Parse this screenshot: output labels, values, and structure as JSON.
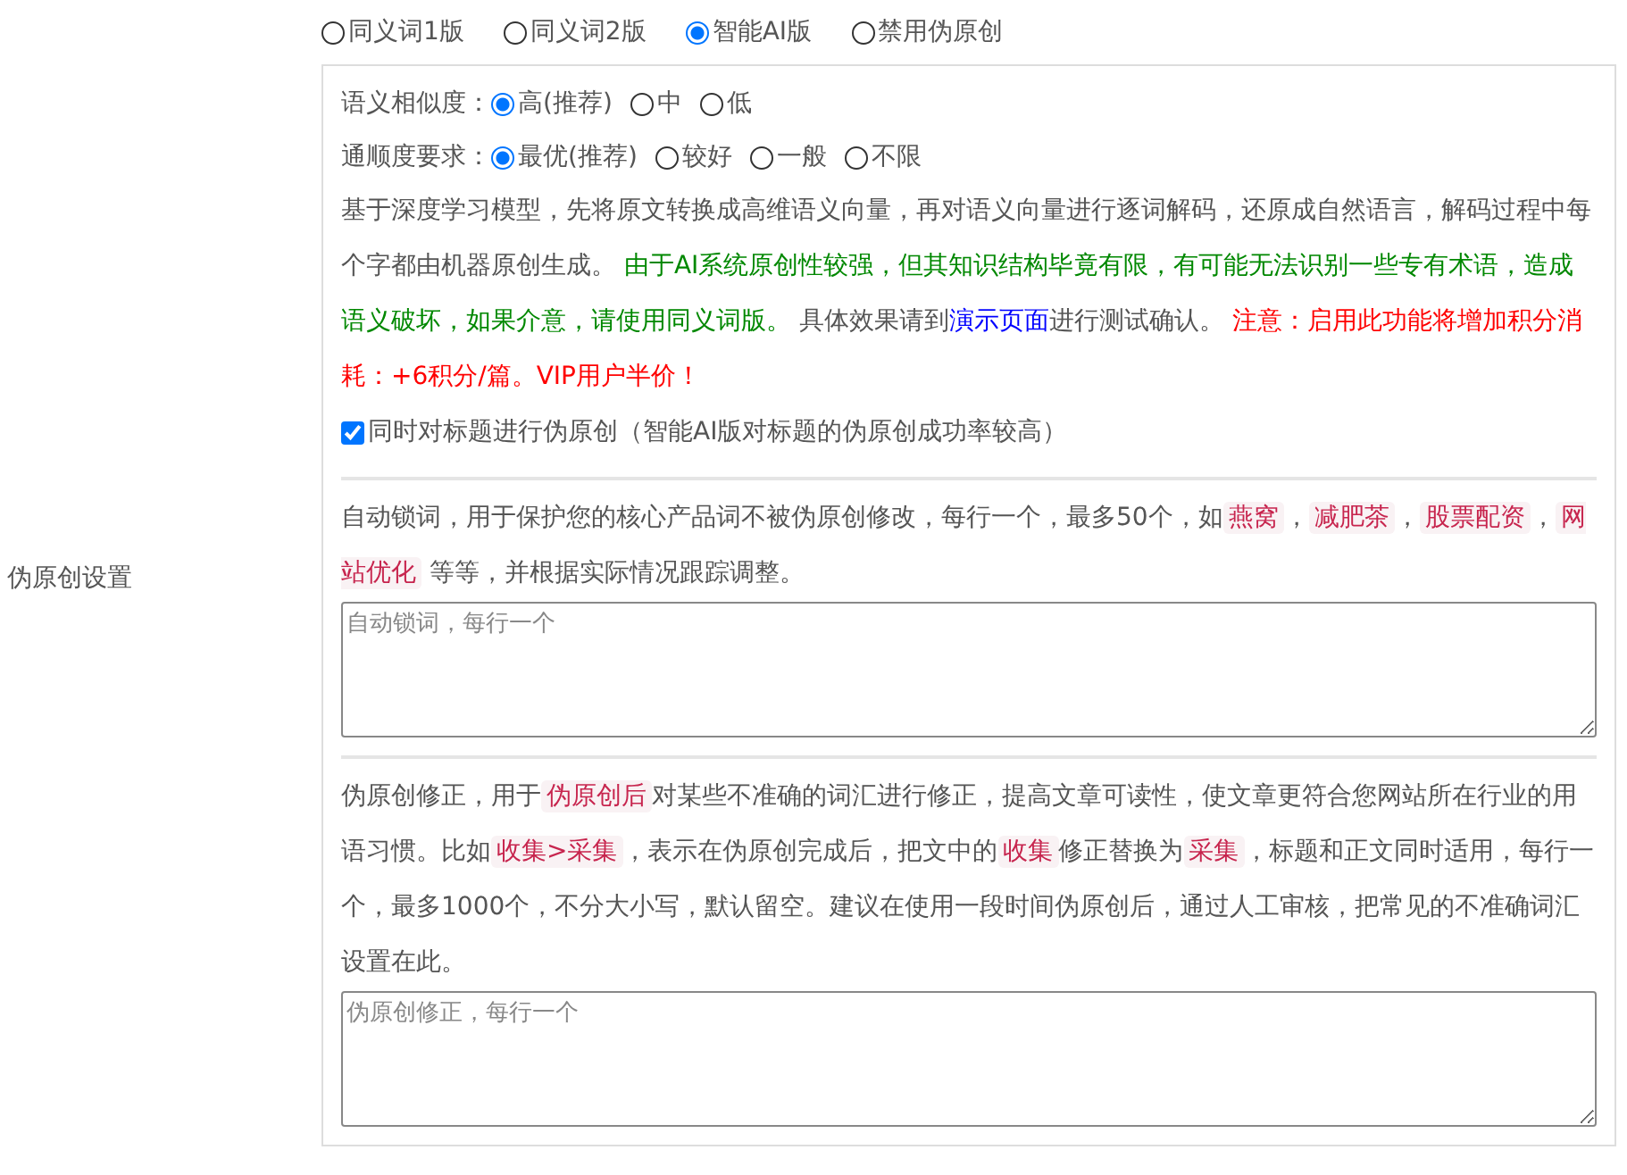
{
  "modes": [
    {
      "label": "同义词1版",
      "selected": false
    },
    {
      "label": "同义词2版",
      "selected": false
    },
    {
      "label": "智能AI版",
      "selected": true
    },
    {
      "label": "禁用伪原创",
      "selected": false
    }
  ],
  "section_label": "伪原创设置",
  "option_groups": [
    {
      "label": "语义相似度：",
      "options": [
        {
          "label": "高(推荐)",
          "selected": true
        },
        {
          "label": "中",
          "selected": false
        },
        {
          "label": "低",
          "selected": false
        }
      ]
    },
    {
      "label": "通顺度要求：",
      "options": [
        {
          "label": "最优(推荐)",
          "selected": true
        },
        {
          "label": "较好",
          "selected": false
        },
        {
          "label": "一般",
          "selected": false
        },
        {
          "label": "不限",
          "selected": false
        }
      ]
    }
  ],
  "description": [
    {
      "kind": "text",
      "text": "基于深度学习模型，先将原文转换成高维语义向量，再对语义向量进行逐词解码，还原成自然语言，解码过程中每个字都由机器原创生成。 "
    },
    {
      "kind": "green",
      "text": "由于AI系统原创性较强，但其知识结构毕竟有限，有可能无法识别一些专有术语，造成语义破坏，如果介意，请使用同义词版。"
    },
    {
      "kind": "text",
      "text": " 具体效果请到"
    },
    {
      "kind": "link",
      "text": "演示页面"
    },
    {
      "kind": "text",
      "text": "进行测试确认。 "
    },
    {
      "kind": "red",
      "text": "注意：启用此功能将增加积分消耗：+6积分/篇。VIP用户半价！"
    }
  ],
  "title_checkbox": {
    "label": "同时对标题进行伪原创（智能AI版对标题的伪原创成功率较高）",
    "checked": true
  },
  "lock_words": {
    "text": [
      {
        "kind": "text",
        "text": "自动锁词，用于保护您的核心产品词不被伪原创修改，每行一个，最多50个，如"
      },
      {
        "kind": "code",
        "text": "燕窝"
      },
      {
        "kind": "text",
        "text": "，"
      },
      {
        "kind": "code",
        "text": "减肥茶"
      },
      {
        "kind": "text",
        "text": "，"
      },
      {
        "kind": "code",
        "text": "股票配资"
      },
      {
        "kind": "text",
        "text": "，"
      },
      {
        "kind": "code",
        "text": "网站优化"
      },
      {
        "kind": "text",
        "text": " 等等，并根据实际情况跟踪调整。"
      }
    ],
    "placeholder": "自动锁词，每行一个"
  },
  "corrections": {
    "text": [
      {
        "kind": "text",
        "text": "伪原创修正，用于"
      },
      {
        "kind": "code",
        "text": "伪原创后"
      },
      {
        "kind": "text",
        "text": "对某些不准确的词汇进行修正，提高文章可读性，使文章更符合您网站所在行业的用语习惯。比如"
      },
      {
        "kind": "code",
        "text": "收集>采集"
      },
      {
        "kind": "text",
        "text": "，表示在伪原创完成后，把文中的"
      },
      {
        "kind": "code",
        "text": "收集"
      },
      {
        "kind": "text",
        "text": "修正替换为"
      },
      {
        "kind": "code",
        "text": "采集"
      },
      {
        "kind": "text",
        "text": "，标题和正文同时适用，每行一个，最多1000个，不分大小写，默认留空。建议在使用一段时间伪原创后，通过人工审核，把常见的不准确词汇设置在此。"
      }
    ],
    "placeholder": "伪原创修正，每行一个"
  }
}
